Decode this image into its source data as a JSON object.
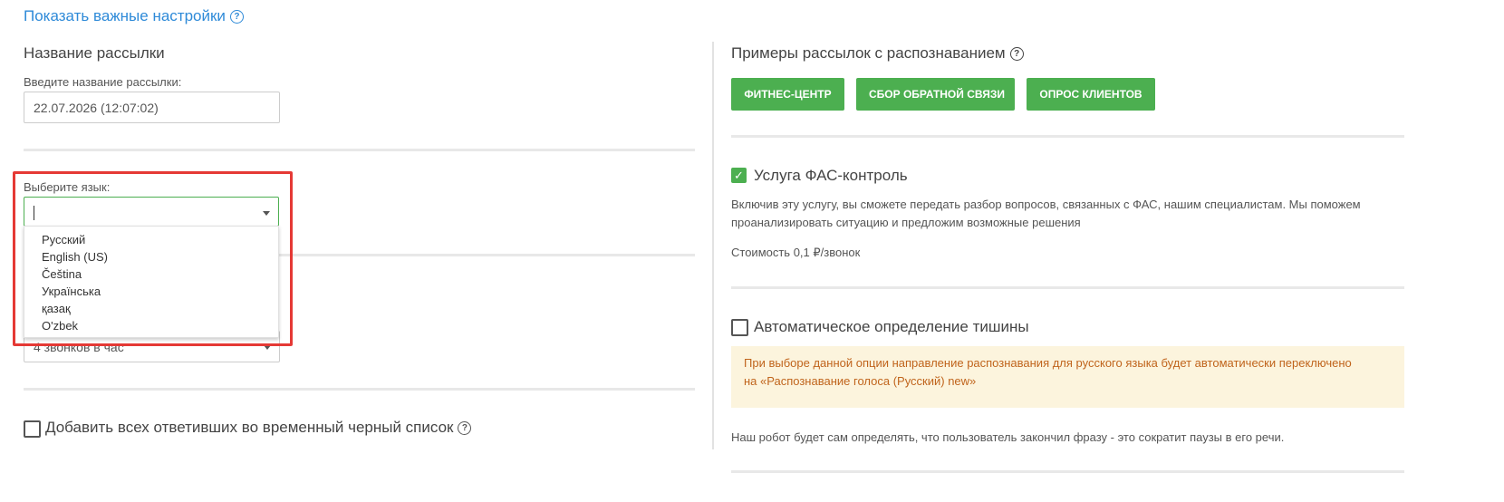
{
  "top_link": {
    "label": "Показать важные настройки"
  },
  "left": {
    "name_section": {
      "title": "Название рассылки",
      "input_label": "Введите название рассылки:",
      "input_value": "22.07.2026 (12:07:02)"
    },
    "language": {
      "label": "Выберите язык:",
      "value": "",
      "options": [
        "Русский",
        "English (US)",
        "Čeština",
        "Українська",
        "қазақ",
        "O'zbek"
      ]
    },
    "rate_select": {
      "value": "4 звонков в час"
    },
    "blacklist": {
      "checked": false,
      "label": "Добавить всех ответивших во временный черный список"
    }
  },
  "right": {
    "examples": {
      "title": "Примеры рассылок с распознаванием",
      "buttons": [
        "ФИТНЕС-ЦЕНТР",
        "СБОР ОБРАТНОЙ СВЯЗИ",
        "ОПРОС КЛИЕНТОВ"
      ]
    },
    "fas": {
      "checked": true,
      "label": "Услуга ФАС-контроль",
      "description_line1": "Включив эту услугу, вы сможете передать разбор вопросов, связанных с ФАС, нашим специалистам. Мы поможем",
      "description_line2": "проанализировать ситуацию и предложим возможные решения",
      "price": "Стоимость 0,1 ₽/звонок"
    },
    "silence": {
      "checked": false,
      "label": "Автоматическое определение тишины",
      "warning_line1": "При выборе данной опции направление распознавания для русского языка будет автоматически переключено",
      "warning_line2": "на «Распознавание голоса (Русский) new»",
      "note": "Наш робот будет сам определять, что пользователь закончил фразу - это сократит паузы в его речи."
    }
  },
  "colors": {
    "accent_link": "#2e8ad8",
    "green": "#4caf50",
    "highlight": "#e53935",
    "warning_bg": "#fcf4dd",
    "warning_text": "#c0641c"
  },
  "icons": [
    "help-icon",
    "chevron-down-icon",
    "check-icon"
  ]
}
